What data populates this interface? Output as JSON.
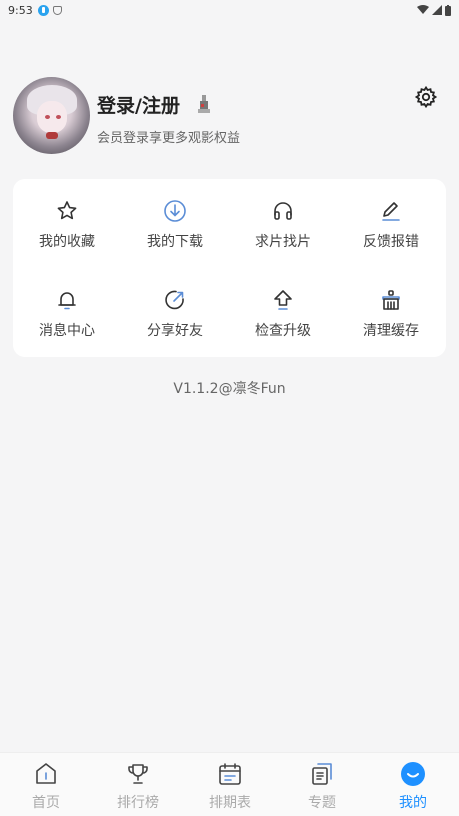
{
  "status_bar": {
    "time": "9:53"
  },
  "profile": {
    "title": "登录/注册",
    "subtitle": "会员登录享更多观影权益"
  },
  "menu": [
    {
      "label": "我的收藏",
      "icon": "star-icon"
    },
    {
      "label": "我的下载",
      "icon": "download-icon"
    },
    {
      "label": "求片找片",
      "icon": "headphones-icon"
    },
    {
      "label": "反馈报错",
      "icon": "edit-icon"
    },
    {
      "label": "消息中心",
      "icon": "bell-icon"
    },
    {
      "label": "分享好友",
      "icon": "share-icon"
    },
    {
      "label": "检查升级",
      "icon": "upgrade-icon"
    },
    {
      "label": "清理缓存",
      "icon": "clean-icon"
    }
  ],
  "version": "V1.1.2@凛冬Fun",
  "tabs": [
    {
      "label": "首页",
      "icon": "home-icon",
      "active": false
    },
    {
      "label": "排行榜",
      "icon": "trophy-icon",
      "active": false
    },
    {
      "label": "排期表",
      "icon": "calendar-icon",
      "active": false
    },
    {
      "label": "专题",
      "icon": "topic-icon",
      "active": false
    },
    {
      "label": "我的",
      "icon": "profile-icon",
      "active": true
    }
  ],
  "colors": {
    "accent": "#1e90ff",
    "icon": "#333333",
    "download_icon": "#5b8dd6",
    "background": "#f5f5f6"
  }
}
